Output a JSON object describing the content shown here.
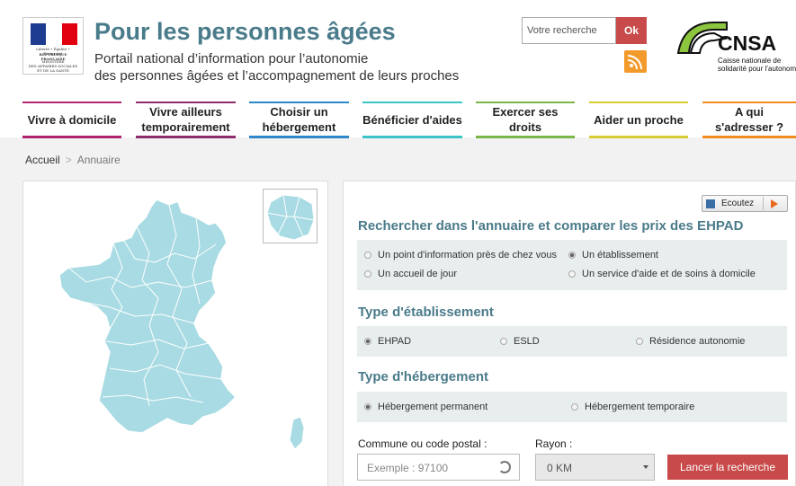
{
  "header": {
    "gov_logo": {
      "top_text": "Liberté • Égalité • Fraternité",
      "republic": "RÉPUBLIQUE FRANÇAISE",
      "ministry1": "MINISTÈRE",
      "ministry2": "DES AFFAIRES SOCIALES",
      "ministry3": "ET DE LA SANTÉ",
      "flag_colors": [
        "#1d3c8f",
        "#ffffff",
        "#e1000f"
      ]
    },
    "title": "Pour les personnes âgées",
    "subtitle_line1": "Portail national d’information pour l’autonomie",
    "subtitle_line2": "des personnes âgées et l’accompagnement de leurs proches",
    "search_placeholder": "Votre recherche",
    "search_button": "Ok",
    "rss_icon": "rss-icon",
    "cnsa": {
      "name": "CNSA",
      "caption1": "Caisse nationale de",
      "caption2": "solidarité pour l’autonomie",
      "arc_color": "#8cc63f"
    }
  },
  "nav": [
    {
      "label": "Vivre à domicile",
      "color": "#b0246e"
    },
    {
      "label": "Vivre ailleurs temporairement",
      "color": "#8e2b6c"
    },
    {
      "label": "Choisir un hébergement",
      "color": "#2c88c8"
    },
    {
      "label": "Bénéficier d'aides",
      "color": "#3cc5c6"
    },
    {
      "label": "Exercer ses droits",
      "color": "#7ab648"
    },
    {
      "label": "Aider un proche",
      "color": "#d7cc32"
    },
    {
      "label": "A qui s'adresser ?",
      "color": "#f28c1e"
    }
  ],
  "breadcrumb": {
    "home": "Accueil",
    "separator": ">",
    "current": "Annuaire"
  },
  "map": {
    "fill_color": "#a8dbe3",
    "border_color": "#ffffff"
  },
  "form": {
    "listen_label": "Ecoutez",
    "title": "Rechercher dans l'annuaire et comparer les prix des EHPAD",
    "search_types": [
      {
        "label": "Un point d'information près de chez vous",
        "checked": false
      },
      {
        "label": "Un établissement",
        "checked": true
      },
      {
        "label": "Un accueil de jour",
        "checked": false
      },
      {
        "label": "Un service d'aide et de soins à domicile",
        "checked": false
      }
    ],
    "etab_title": "Type d'établissement",
    "etab_types": [
      {
        "label": "EHPAD",
        "checked": true
      },
      {
        "label": "ESLD",
        "checked": false
      },
      {
        "label": "Résidence autonomie",
        "checked": false
      }
    ],
    "heberg_title": "Type d'hébergement",
    "heberg_types": [
      {
        "label": "Hébergement permanent",
        "checked": true
      },
      {
        "label": "Hébergement temporaire",
        "checked": false
      }
    ],
    "commune_label": "Commune ou code postal :",
    "commune_placeholder": "Exemple : 97100",
    "rayon_label": "Rayon :",
    "rayon_value": "0 KM",
    "launch_button": "Lancer la recherche"
  }
}
